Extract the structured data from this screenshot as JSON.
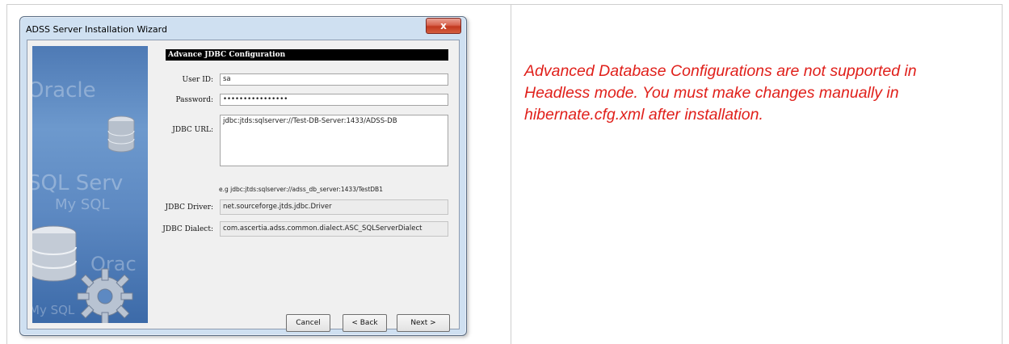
{
  "window": {
    "title": "ADSS Server Installation Wizard",
    "close_label": "x"
  },
  "banner": {
    "watermarks": [
      "Oracle",
      "SQL Serv",
      "My SQL",
      "Orac",
      "My SQL"
    ]
  },
  "panel": {
    "header": "Advance JDBC Configuration",
    "user_id": {
      "label": "User ID:",
      "value": "sa"
    },
    "password": {
      "label": "Password:",
      "value": "••••••••••••••••"
    },
    "jdbc_url": {
      "label": "JDBC URL:",
      "value": "jdbc:jtds:sqlserver://Test-DB-Server:1433/ADSS-DB",
      "hint": "e.g jdbc:jtds:sqlserver://adss_db_server:1433/TestDB1"
    },
    "jdbc_driver": {
      "label": "JDBC Driver:",
      "value": "net.sourceforge.jtds.jdbc.Driver"
    },
    "jdbc_dialect": {
      "label": "JDBC Dialect:",
      "value": "com.ascertia.adss.common.dialect.ASC_SQLServerDialect"
    }
  },
  "buttons": {
    "cancel": "Cancel",
    "back": "< Back",
    "next": "Next >"
  },
  "note": "Advanced Database Configurations are not supported in Headless mode. You must make changes manually in hibernate.cfg.xml after installation."
}
